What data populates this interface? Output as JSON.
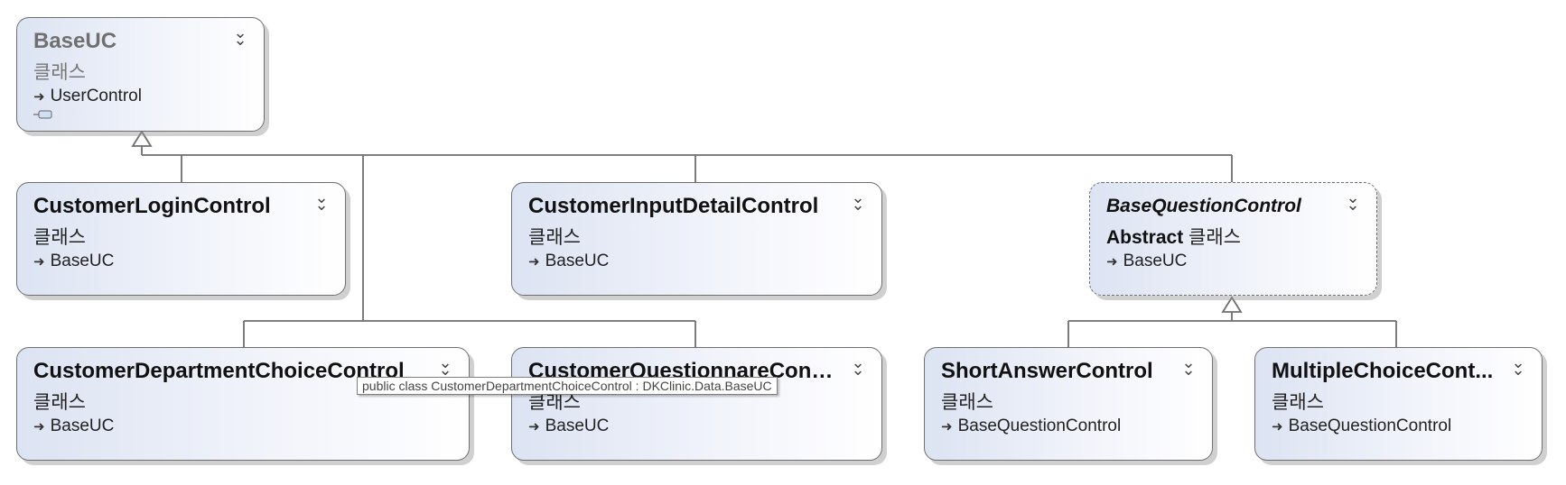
{
  "classes": [
    {
      "name": "BaseUC",
      "kind": "클래스",
      "base": "UserControl"
    },
    {
      "name": "CustomerLoginControl",
      "kind": "클래스",
      "base": "BaseUC"
    },
    {
      "name": "CustomerInputDetailControl",
      "kind": "클래스",
      "base": "BaseUC"
    },
    {
      "name": "BaseQuestionControl",
      "modifier": "Abstract",
      "kind": "클래스",
      "base": "BaseUC"
    },
    {
      "name": "CustomerDepartmentChoiceControl",
      "kind": "클래스",
      "base": "BaseUC"
    },
    {
      "name": "CustomerQuestionnareCont...",
      "kind": "클래스",
      "base": "BaseUC"
    },
    {
      "name": "ShortAnswerControl",
      "kind": "클래스",
      "base": "BaseQuestionControl"
    },
    {
      "name": "MultipleChoiceCont...",
      "kind": "클래스",
      "base": "BaseQuestionControl"
    }
  ],
  "tooltip": "public class CustomerDepartmentChoiceControl : DKClinic.Data.BaseUC",
  "icons": {
    "collapse": "double-chevron-down-icon",
    "inheritance": "arrow-right-icon"
  }
}
